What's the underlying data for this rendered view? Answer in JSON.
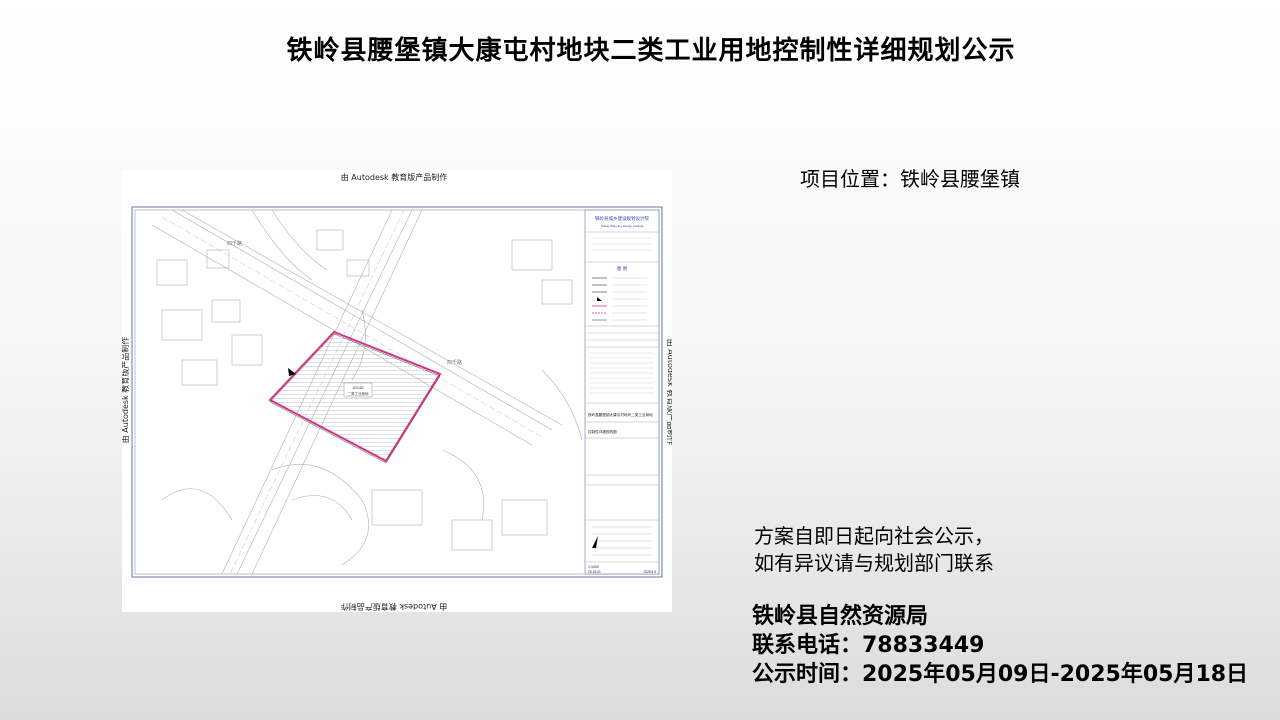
{
  "header": {
    "title": "铁岭县腰堡镇大康屯村地块二类工业用地控制性详细规划公示"
  },
  "project": {
    "location_text": "项目位置：铁岭县腰堡镇"
  },
  "notice": {
    "line1": "方案自即日起向社会公示，",
    "line2": "如有异议请与规划部门联系"
  },
  "contact": {
    "bureau": "铁岭县自然资源局",
    "phone_line": "联系电话：78833449",
    "period_line": "公示时间：2025年05月09日-2025年05月18日"
  },
  "map": {
    "watermark": "由 Autodesk 教育版产品制作",
    "institute_cn": "铁岭县城乡建设规划设计院",
    "institute_en": "Tieling Planning Design Institute",
    "legend_title": "图 例",
    "project_name": "铁岭县腰堡镇大康屯村地块二类工业用地",
    "drawing_name": "控制性详细规划图",
    "parcel_code": "100182",
    "parcel_type": "二类工业用地",
    "scale": "1:1000",
    "sheet_no": "25-15-01",
    "date": "2025.5.9",
    "road_label": "四千路"
  },
  "colors": {
    "boundary": "#d63384",
    "line": "#9a9a9a",
    "frame": "#5a6a9a"
  }
}
